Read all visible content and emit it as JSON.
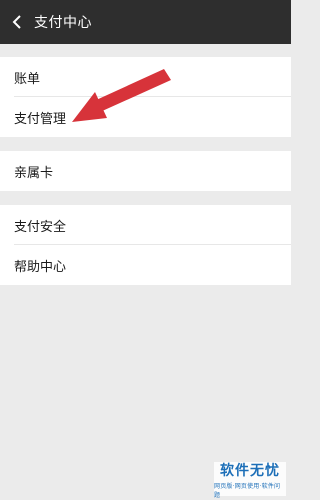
{
  "header": {
    "title": "支付中心",
    "back_icon": "chevron-left-icon"
  },
  "groups": [
    {
      "items": [
        {
          "label": "账单"
        },
        {
          "label": "支付管理"
        }
      ]
    },
    {
      "items": [
        {
          "label": "亲属卡"
        }
      ]
    },
    {
      "items": [
        {
          "label": "支付安全"
        },
        {
          "label": "帮助中心"
        }
      ]
    }
  ],
  "annotation": {
    "type": "arrow",
    "color": "#d7333a",
    "points_to": "支付管理"
  },
  "watermark": {
    "main": "软件无忧",
    "sub": "网页版·网页使用·软件问题"
  },
  "colors": {
    "titlebar": "#2e2e2e",
    "background": "#ebebeb",
    "cell": "#ffffff"
  }
}
